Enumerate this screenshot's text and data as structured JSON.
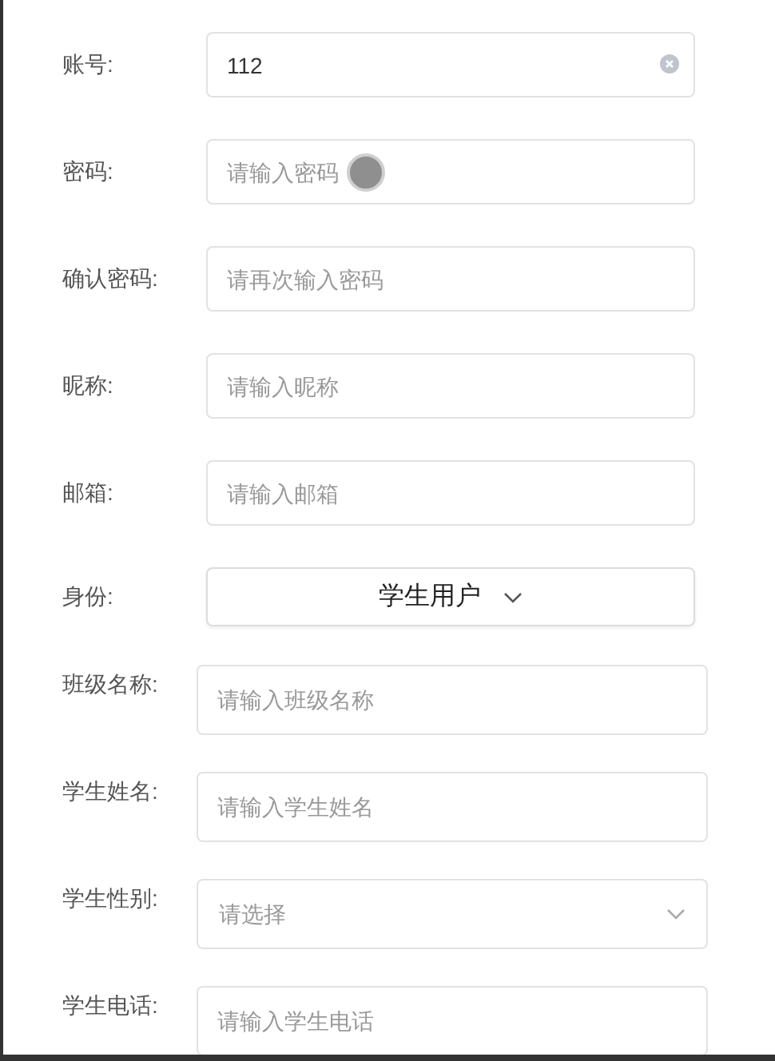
{
  "account_fields": [
    {
      "label": "账号:",
      "kind": "input",
      "value": "112"
    },
    {
      "label": "密码:",
      "kind": "input",
      "placeholder": "请输入密码"
    },
    {
      "label": "确认密码:",
      "kind": "input",
      "placeholder": "请再次输入密码"
    },
    {
      "label": "昵称:",
      "kind": "input",
      "placeholder": "请输入昵称"
    },
    {
      "label": "邮箱:",
      "kind": "input",
      "placeholder": "请输入邮箱"
    },
    {
      "label": "身份:",
      "kind": "dropdown",
      "value": "学生用户"
    }
  ],
  "student_fields": [
    {
      "label": "班级名称:",
      "kind": "input",
      "placeholder": "请输入班级名称"
    },
    {
      "label": "学生姓名:",
      "kind": "input",
      "placeholder": "请输入学生姓名"
    },
    {
      "label": "学生性别:",
      "kind": "select",
      "placeholder": "请选择"
    },
    {
      "label": "学生电话:",
      "kind": "input",
      "placeholder": "请输入学生电话"
    }
  ]
}
